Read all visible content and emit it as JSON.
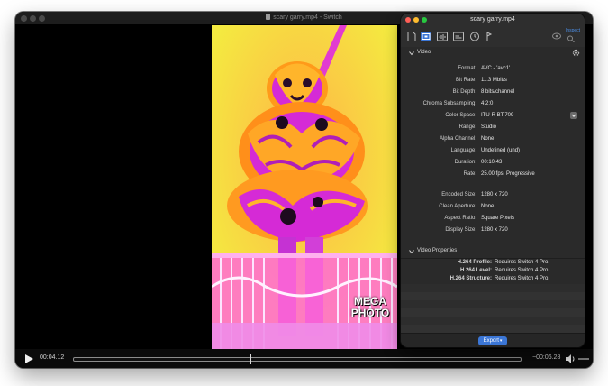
{
  "window": {
    "title": "scary garry.mp4 - Switch"
  },
  "player": {
    "current_time": "00:04.12",
    "remaining_time": "−00:06.28",
    "progress": 0.396
  },
  "video_overlay": {
    "watermark_line1": "MEGA",
    "watermark_line2": "PHOTO"
  },
  "inspector": {
    "title": "scary garry.mp4",
    "inspector_tab_label": "Inspect",
    "toolbar_icons": [
      "document-icon",
      "video-track-icon",
      "audio-track-icon",
      "subtitle-track-icon",
      "chapters-icon",
      "metadata-icon"
    ],
    "video_section": {
      "title": "Video",
      "rows": [
        {
          "label": "Format:",
          "value": "AVC - 'avc1'"
        },
        {
          "label": "Bit Rate:",
          "value": "11.3 Mbit/s"
        },
        {
          "label": "Bit Depth:",
          "value": "8 bits/channel"
        },
        {
          "label": "Chroma Subsampling:",
          "value": "4:2:0"
        },
        {
          "label": "Color Space:",
          "value": "ITU-R BT.709"
        },
        {
          "label": "Range:",
          "value": "Studio"
        },
        {
          "label": "Alpha Channel:",
          "value": "None"
        },
        {
          "label": "Language:",
          "value": "Undefined (und)"
        },
        {
          "label": "Duration:",
          "value": "00:10.43"
        },
        {
          "label": "Rate:",
          "value": "25.00 fps, Progressive"
        },
        {
          "label": "Encoded Size:",
          "value": "1280 x 720"
        },
        {
          "label": "Clean Aperture:",
          "value": "None"
        },
        {
          "label": "Aspect Ratio:",
          "value": "Square Pixels"
        },
        {
          "label": "Display Size:",
          "value": "1280 x 720"
        }
      ]
    },
    "video_properties_section": {
      "title": "Video Properties",
      "rows": [
        {
          "label": "H.264 Profile:",
          "value": "Requires Switch 4 Pro."
        },
        {
          "label": "H.264 Level:",
          "value": "Requires Switch 4 Pro."
        },
        {
          "label": "H.264 Structure:",
          "value": "Requires Switch 4 Pro."
        }
      ]
    },
    "export_label": "Export",
    "colors": {
      "accent": "#3b76d6",
      "close": "#ff5f57",
      "minimize": "#febc2e",
      "zoom": "#28c840"
    }
  }
}
